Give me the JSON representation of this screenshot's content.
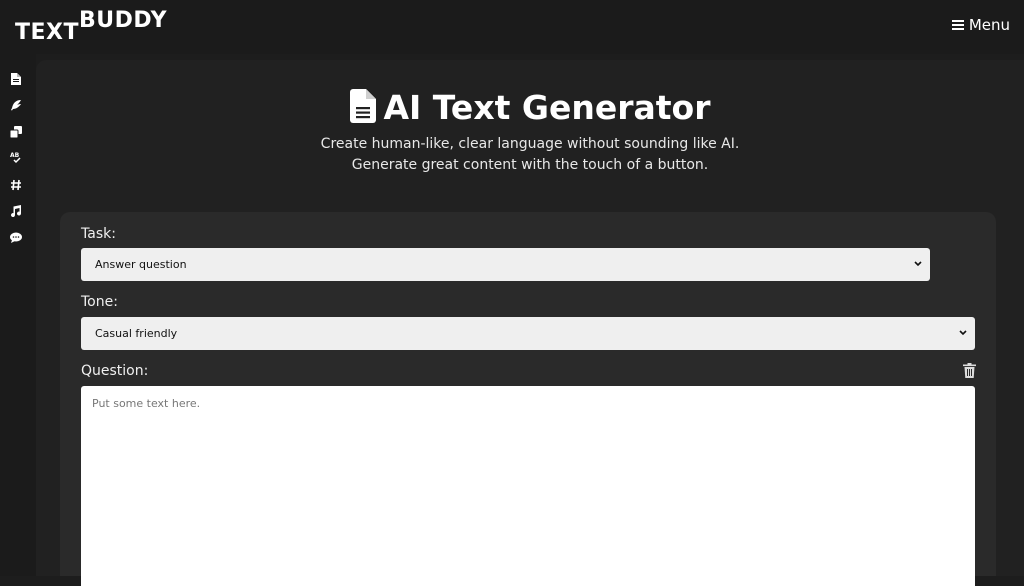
{
  "brand": {
    "part1": "TEXT",
    "part2": "BUDDY"
  },
  "header": {
    "menu_label": "Menu"
  },
  "sidebar": {
    "items": [
      {
        "icon": "document-icon"
      },
      {
        "icon": "feather-pen-icon"
      },
      {
        "icon": "copy-icon"
      },
      {
        "icon": "spellcheck-icon"
      },
      {
        "icon": "hashtag-icon"
      },
      {
        "icon": "music-icon"
      },
      {
        "icon": "chat-icon"
      }
    ]
  },
  "page": {
    "title": "AI Text Generator",
    "subtitle_line1": "Create human-like, clear language without sounding like AI.",
    "subtitle_line2": "Generate great content with the touch of a button."
  },
  "form": {
    "task_label": "Task:",
    "task_value": "Answer question",
    "tone_label": "Tone:",
    "tone_value": "Casual friendly",
    "question_label": "Question:",
    "question_placeholder": "Put some text here."
  }
}
